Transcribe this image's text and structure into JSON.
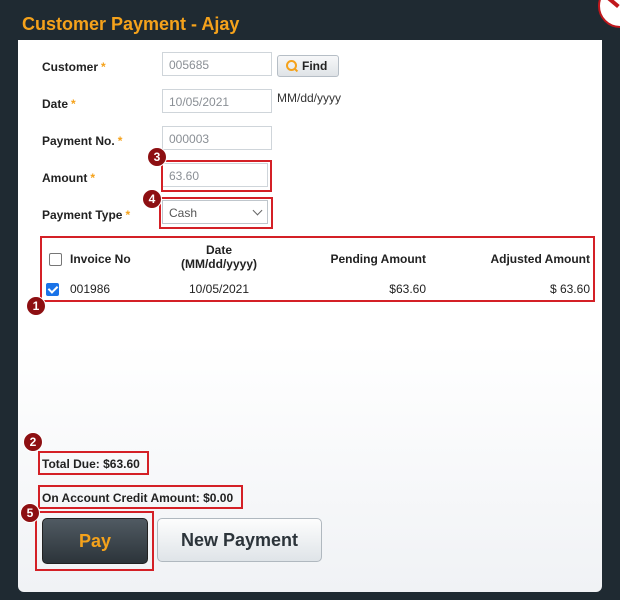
{
  "window": {
    "title": "Customer Payment - Ajay"
  },
  "form": {
    "customer": {
      "label": "Customer",
      "value": "005685"
    },
    "find_label": "Find",
    "date": {
      "label": "Date",
      "value": "10/05/2021",
      "format_hint": "MM/dd/yyyy"
    },
    "payment_no": {
      "label": "Payment No.",
      "value": "000003"
    },
    "amount": {
      "label": "Amount",
      "value": "63.60"
    },
    "payment_type": {
      "label": "Payment Type",
      "value": "Cash"
    },
    "required_marker": "*"
  },
  "table": {
    "headers": {
      "invoice_no": "Invoice No",
      "date_line1": "Date",
      "date_line2": "(MM/dd/yyyy)",
      "pending_amount": "Pending Amount",
      "adjusted_amount": "Adjusted Amount"
    },
    "rows": [
      {
        "checked": true,
        "invoice_no": "001986",
        "date": "10/05/2021",
        "pending_amount": "$63.60",
        "adjusted_amount": "$ 63.60"
      }
    ]
  },
  "summary": {
    "total_due": "Total Due: $63.60",
    "on_account_credit": "On Account Credit Amount: $0.00"
  },
  "actions": {
    "pay_label": "Pay",
    "new_payment_label": "New Payment"
  },
  "annotations": {
    "n1": "1",
    "n2": "2",
    "n3": "3",
    "n4": "4",
    "n5": "5"
  },
  "colors": {
    "accent": "#f5a21b",
    "annotation_red": "#d42026",
    "badge": "#8d0f12",
    "checkbox": "#1a73e8"
  }
}
